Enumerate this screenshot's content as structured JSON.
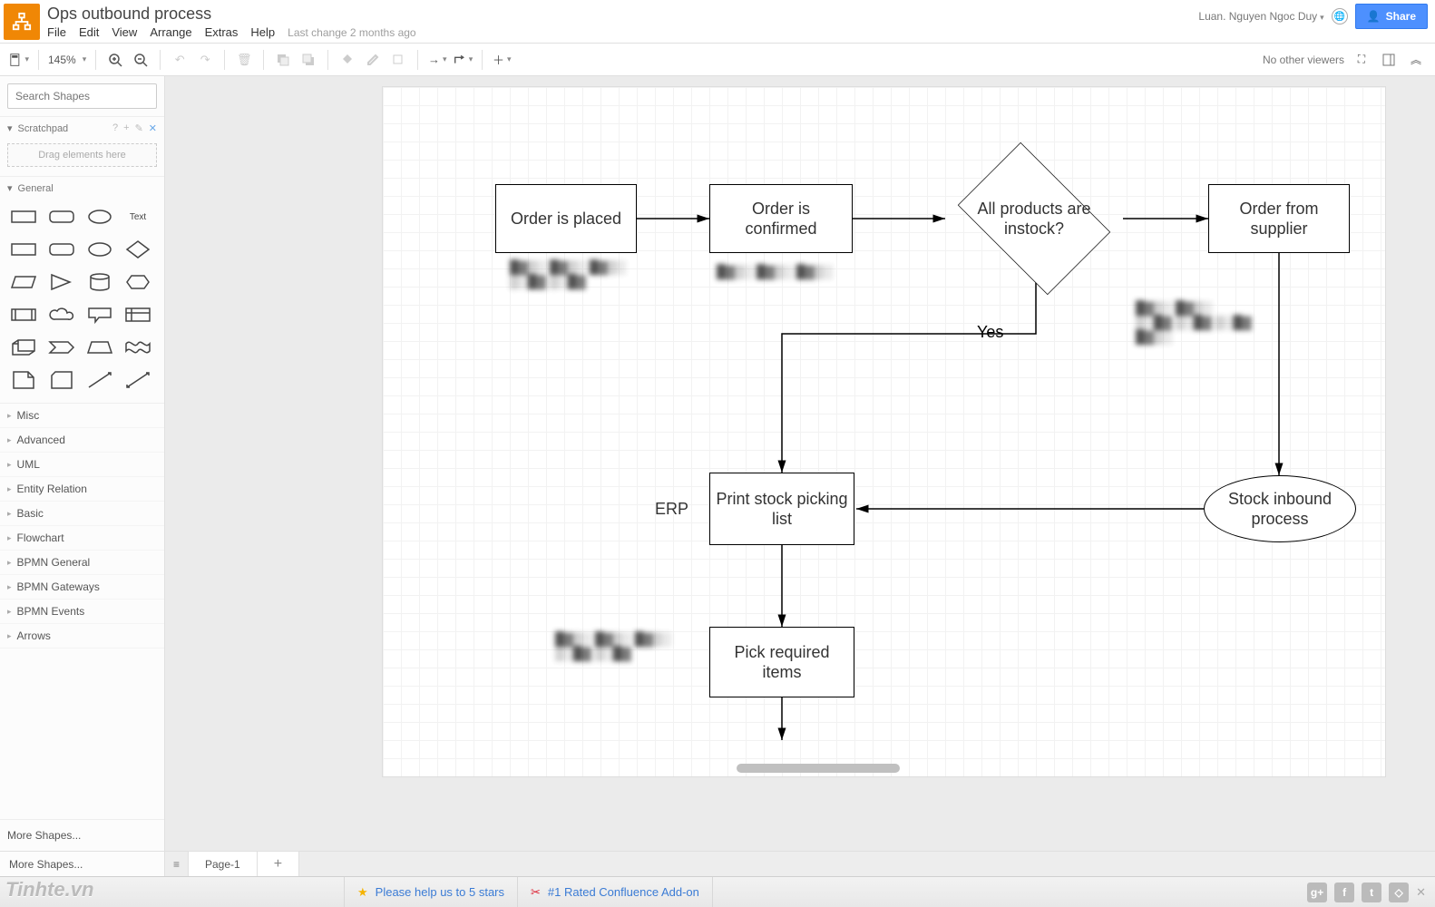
{
  "app": {
    "doc_title": "Ops outbound process",
    "user_name": "Luan. Nguyen Ngoc Duy",
    "share_label": "Share",
    "last_change": "Last change 2 months ago"
  },
  "menubar": {
    "items": [
      "File",
      "Edit",
      "View",
      "Arrange",
      "Extras",
      "Help"
    ]
  },
  "toolbar": {
    "zoom": "145%",
    "no_viewers": "No other viewers"
  },
  "sidebar": {
    "search_placeholder": "Search Shapes",
    "scratchpad_label": "Scratchpad",
    "scratchpad_hint": "Drag elements here",
    "general_label": "General",
    "shape_text_label": "Text",
    "libs": [
      "Misc",
      "Advanced",
      "UML",
      "Entity Relation",
      "Basic",
      "Flowchart",
      "BPMN General",
      "BPMN Gateways",
      "BPMN Events",
      "Arrows"
    ],
    "more_shapes": "More Shapes..."
  },
  "tabs": {
    "page1": "Page-1"
  },
  "diagram": {
    "nodes": {
      "order_placed": "Order is placed",
      "order_confirmed": "Order is confirmed",
      "all_instock": "All products are instock?",
      "order_supplier": "Order from supplier",
      "print_picklist": "Print stock picking list",
      "stock_inbound": "Stock inbound process",
      "pick_items": "Pick required items"
    },
    "edge_labels": {
      "yes": "Yes"
    },
    "annotations": {
      "erp": "ERP"
    }
  },
  "footer": {
    "rate_label": "Please help us to 5 stars",
    "addon_label": "#1 Rated Confluence Add-on"
  },
  "watermark": "Tinhte.vn"
}
